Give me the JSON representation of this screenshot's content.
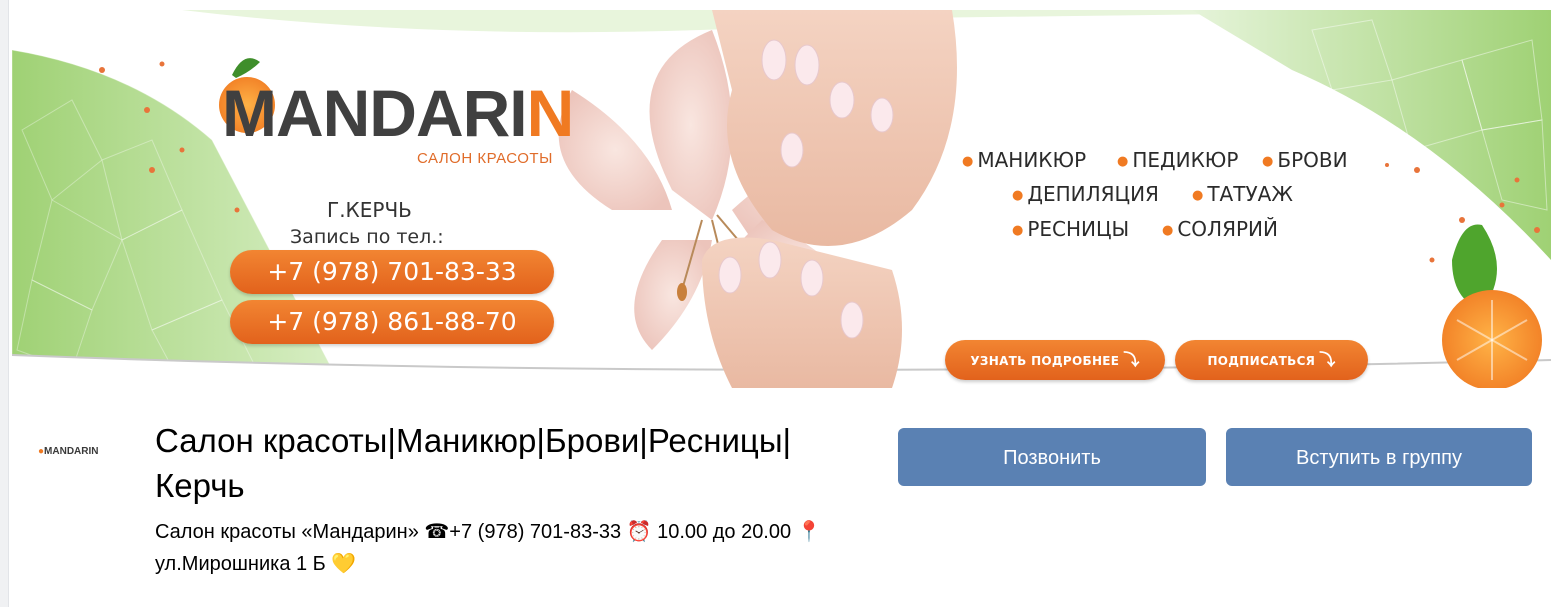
{
  "cover": {
    "brand_name_main": "MANDARI",
    "brand_name_last": "N",
    "brand_subtitle": "САЛОН КРАСОТЫ",
    "city": "Г.КЕРЧЬ",
    "booking_label": "Запись по тел.:",
    "phones": [
      "+7 (978) 701-83-33",
      "+7 (978) 861-88-70"
    ],
    "services": [
      "МАНИКЮР",
      "ПЕДИКЮР",
      "БРОВИ",
      "ДЕПИЛЯЦИЯ",
      "ТАТУАЖ",
      "РЕСНИЦЫ",
      "СОЛЯРИЙ"
    ],
    "cta_more": "УЗНАТЬ ПОДРОБНЕЕ",
    "cta_subscribe": "ПОДПИСАТЬСЯ",
    "colors": {
      "accent": "#f07a22",
      "green": "#a8d67e",
      "dark_text": "#404040"
    }
  },
  "group": {
    "avatar_text": "MANDARIN",
    "title": "Салон красоты|Маникюр|Брови|Ресницы|Керчь",
    "description": "Салон красоты «Мандарин» ☎+7 (978) 701-83-33 ⏰ 10.00 до 20.00 📍 ул.Мирошника 1 Б 💛"
  },
  "actions": {
    "call_label": "Позвонить",
    "join_label": "Вступить в группу",
    "button_color": "#5a81b3"
  }
}
